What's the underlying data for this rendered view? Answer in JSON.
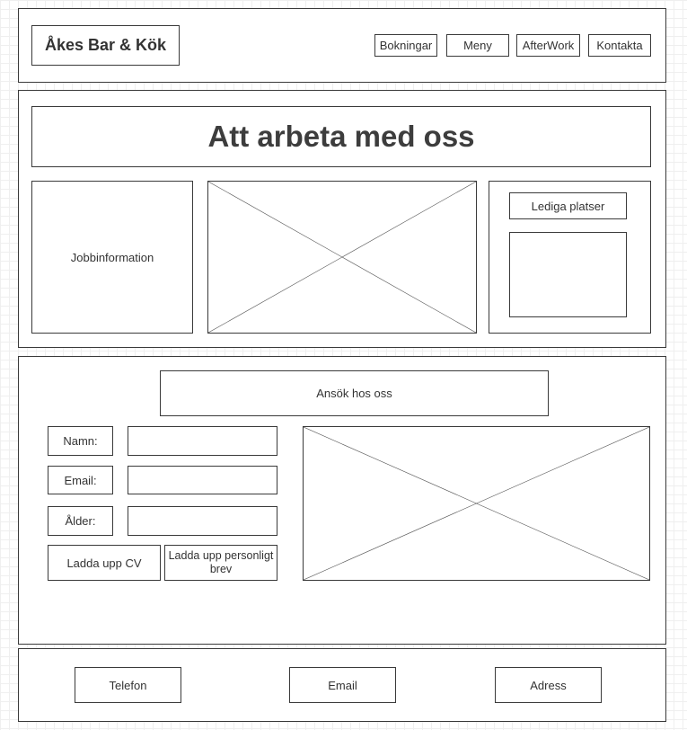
{
  "header": {
    "logo": "Åkes Bar & Kök",
    "nav": [
      "Bokningar",
      "Meny",
      "AfterWork",
      "Kontakta"
    ]
  },
  "hero": {
    "title": "Att arbeta med oss",
    "job_info": "Jobbinformation",
    "image_icon": "image-placeholder-icon",
    "openings_button": "Lediga platser"
  },
  "apply": {
    "title": "Ansök hos oss",
    "labels": {
      "name": "Namn:",
      "email": "Email:",
      "age": "Ålder:"
    },
    "upload_cv": "Ladda upp CV",
    "upload_letter": "Ladda upp personligt brev",
    "image_icon": "image-placeholder-icon"
  },
  "footer": {
    "phone": "Telefon",
    "email": "Email",
    "address": "Adress"
  },
  "colors": {
    "border": "#3a3a3a",
    "text": "#333333",
    "grid": "#efefef"
  }
}
